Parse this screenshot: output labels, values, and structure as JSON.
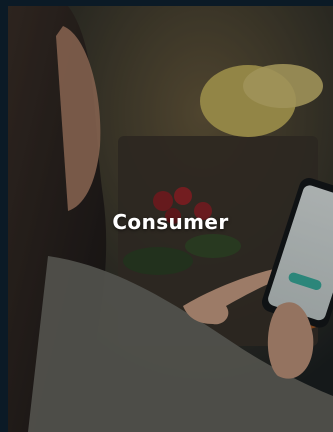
{
  "tile": {
    "title": "Consumer",
    "background_scene": "woman-using-smartphone-near-groceries"
  },
  "colors": {
    "page_background": "#0b1a26",
    "title_text": "#ffffff",
    "phone_accent": "#3ab5a3"
  }
}
